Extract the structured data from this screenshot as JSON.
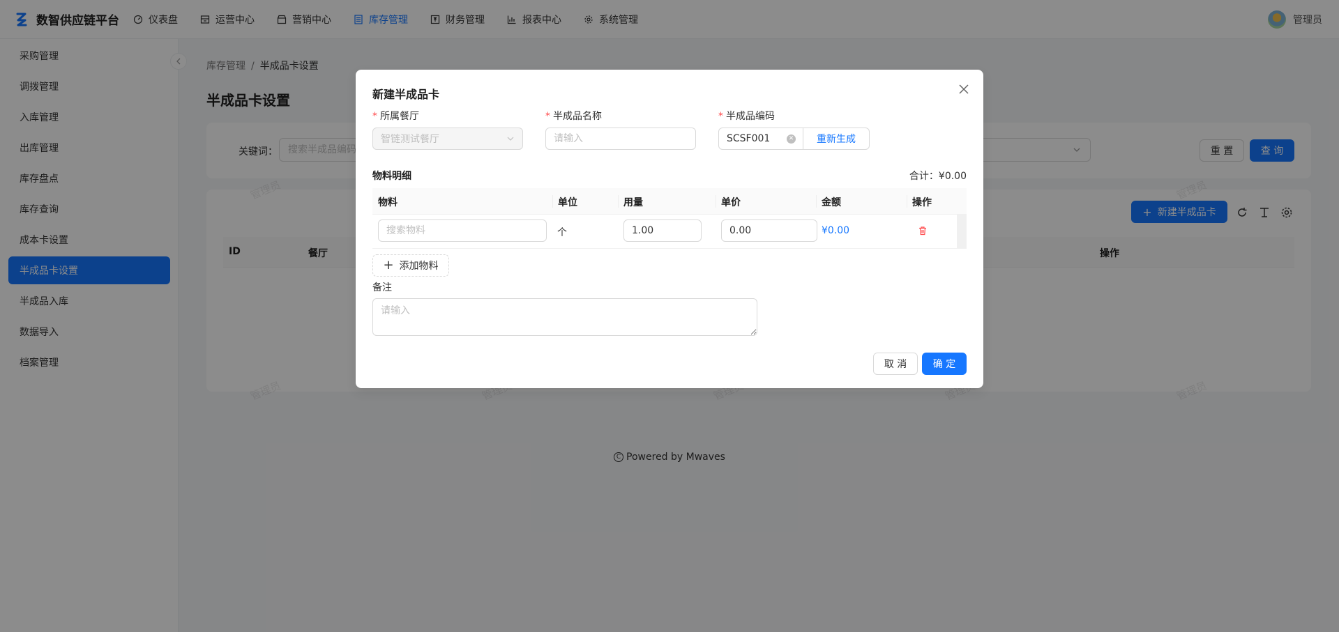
{
  "app": {
    "title": "数智供应链平台",
    "user": "管理员"
  },
  "nav": [
    {
      "label": "仪表盘",
      "icon": "dashboard-icon"
    },
    {
      "label": "运营中心",
      "icon": "store-icon"
    },
    {
      "label": "营销中心",
      "icon": "shop-icon"
    },
    {
      "label": "库存管理",
      "icon": "list-icon"
    },
    {
      "label": "财务管理",
      "icon": "money-icon"
    },
    {
      "label": "报表中心",
      "icon": "chart-icon"
    },
    {
      "label": "系统管理",
      "icon": "gear-icon"
    }
  ],
  "active_nav": "库存管理",
  "sidebar": {
    "items": [
      "采购管理",
      "调拨管理",
      "入库管理",
      "出库管理",
      "库存盘点",
      "库存查询",
      "成本卡设置",
      "半成品卡设置",
      "半成品入库",
      "数据导入",
      "档案管理"
    ],
    "active": "半成品卡设置"
  },
  "breadcrumb": {
    "parent": "库存管理",
    "sep": "/",
    "current": "半成品卡设置"
  },
  "page": {
    "title": "半成品卡设置"
  },
  "search": {
    "label": "关键词：",
    "placeholder": "搜索半成品编码",
    "reset": "重 置",
    "query": "查 询"
  },
  "table": {
    "new_button": "新建半成品卡",
    "columns": {
      "id": "ID",
      "restaurant": "餐厅",
      "actions": "操作"
    }
  },
  "watermark": "管理员",
  "footer": {
    "copy_glyph": "C",
    "text": "Powered by Mwaves"
  },
  "modal": {
    "title": "新建半成品卡",
    "fields": {
      "restaurant": {
        "label": "所属餐厅",
        "value": "智链测试餐厅"
      },
      "name": {
        "label": "半成品名称",
        "placeholder": "请输入"
      },
      "code": {
        "label": "半成品编码",
        "value": "SCSF001",
        "regen": "重新生成"
      }
    },
    "materials": {
      "title": "物料明细",
      "total": "合计：¥0.00",
      "columns": [
        "物料",
        "单位",
        "用量",
        "单价",
        "金额",
        "操作"
      ],
      "rows": [
        {
          "placeholder": "搜索物料",
          "unit": "个",
          "qty": "1.00",
          "price": "0.00",
          "amount": "¥0.00"
        }
      ],
      "add": "添加物料"
    },
    "remark": {
      "label": "备注",
      "placeholder": "请输入"
    },
    "cancel": "取 消",
    "ok": "确 定"
  },
  "colors": {
    "primary": "#1677ff",
    "danger": "#ff4d4f"
  }
}
